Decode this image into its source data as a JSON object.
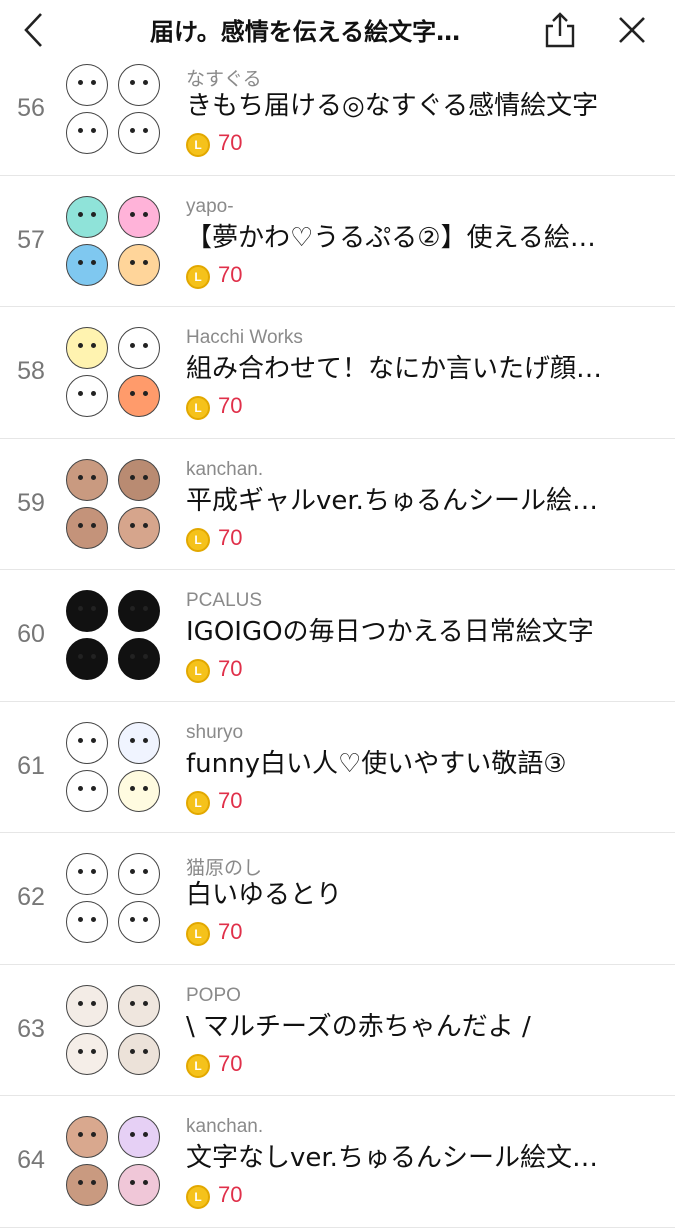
{
  "header": {
    "title": "届け。感情を伝える絵文字…",
    "icons": [
      "back-chevron-icon",
      "share-icon",
      "close-icon"
    ]
  },
  "coin_label": "L",
  "items": [
    {
      "rank": "56",
      "author": "なすぐる",
      "name": "きもち届ける◎なすぐる感情絵文字",
      "price": "70",
      "colors": [
        "#ffffff",
        "#ffffff",
        "#ffffff",
        "#ffffff"
      ]
    },
    {
      "rank": "57",
      "author": "yapo-",
      "name": "【夢かわ♡うるぷる②】使える絵…",
      "price": "70",
      "colors": [
        "#8fe3d9",
        "#ffb3d9",
        "#7fc8f0",
        "#ffd59a"
      ]
    },
    {
      "rank": "58",
      "author": "Hacchi Works",
      "name": "組み合わせて！なにか言いたげ顔…",
      "price": "70",
      "colors": [
        "#fff3b0",
        "#ffffff",
        "#ffffff",
        "#ff9b6b"
      ]
    },
    {
      "rank": "59",
      "author": "kanchan.",
      "name": "平成ギャルver.ちゅるんシール絵…",
      "price": "70",
      "colors": [
        "#c99a80",
        "#b98b72",
        "#c4937a",
        "#d6a58c"
      ]
    },
    {
      "rank": "60",
      "author": "PCALUS",
      "name": "IGOIGOの毎日つかえる日常絵文字",
      "price": "70",
      "colors": [
        "#111111",
        "#111111",
        "#111111",
        "#111111"
      ]
    },
    {
      "rank": "61",
      "author": "shuryo",
      "name": "funny白い人♡使いやすい敬語③",
      "price": "70",
      "colors": [
        "#ffffff",
        "#f0f4ff",
        "#ffffff",
        "#fffbe0"
      ]
    },
    {
      "rank": "62",
      "author": "猫原のし",
      "name": "白いゆるとり",
      "price": "70",
      "colors": [
        "#ffffff",
        "#ffffff",
        "#ffffff",
        "#ffffff"
      ]
    },
    {
      "rank": "63",
      "author": "POPO",
      "name": "\\ マルチーズの赤ちゃんだよ /",
      "price": "70",
      "colors": [
        "#f3ece6",
        "#efe6de",
        "#f5eee8",
        "#ece2d9"
      ]
    },
    {
      "rank": "64",
      "author": "kanchan.",
      "name": "文字なしver.ちゅるんシール絵文…",
      "price": "70",
      "colors": [
        "#d9a88e",
        "#e6d0f5",
        "#c99a80",
        "#f0c7d8"
      ]
    }
  ]
}
